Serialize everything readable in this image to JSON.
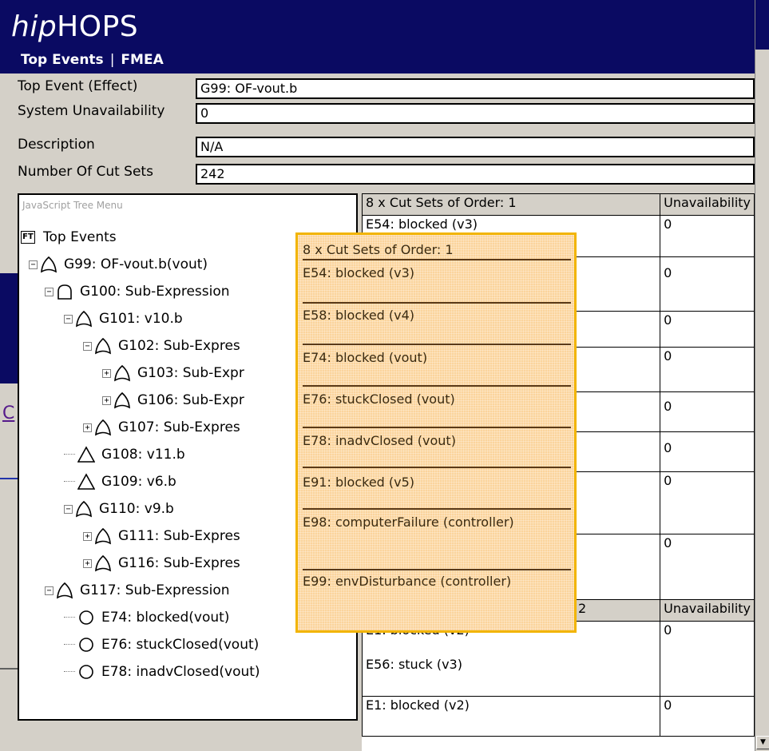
{
  "header": {
    "app_title_italic": "hip",
    "app_title_rest": "HOPS",
    "nav": [
      "Top Events",
      "|",
      "FMEA"
    ]
  },
  "info": [
    {
      "label": "Top Event (Effect)",
      "value": "G99: OF-vout.b"
    },
    {
      "label": "System Unavailability",
      "value": "0"
    },
    {
      "label": "Description",
      "value": "N/A"
    },
    {
      "label": "Number Of Cut Sets",
      "value": "242"
    }
  ],
  "tree": {
    "header": "JavaScript Tree Menu",
    "root_icon": "FT",
    "nodes": [
      {
        "label": "Top Events",
        "icon": "root-icon"
      },
      {
        "label": "G99: OF-vout.b(vout)",
        "icon": "or-gate-icon",
        "toggle": "−"
      },
      {
        "label": "G100: Sub-Expression",
        "icon": "and-gate-icon",
        "toggle": "−"
      },
      {
        "label": "G101: v10.b",
        "icon": "or-gate-icon",
        "toggle": "−"
      },
      {
        "label": "G102: Sub-Expres",
        "icon": "or-gate-icon",
        "toggle": "−"
      },
      {
        "label": "G103: Sub-Expr",
        "icon": "or-gate-icon",
        "toggle": "+"
      },
      {
        "label": "G106: Sub-Expr",
        "icon": "or-gate-icon",
        "toggle": "+"
      },
      {
        "label": "G107: Sub-Expres",
        "icon": "or-gate-icon",
        "toggle": "+"
      },
      {
        "label": "G108: v11.b",
        "icon": "triangle-icon"
      },
      {
        "label": "G109: v6.b",
        "icon": "triangle-icon"
      },
      {
        "label": "G110: v9.b",
        "icon": "or-gate-icon",
        "toggle": "−"
      },
      {
        "label": "G111: Sub-Expres",
        "icon": "or-gate-icon",
        "toggle": "+"
      },
      {
        "label": "G116: Sub-Expres",
        "icon": "or-gate-icon",
        "toggle": "+"
      },
      {
        "label": "G117: Sub-Expression",
        "icon": "or-gate-icon",
        "toggle": "−"
      },
      {
        "label": "E74: blocked(vout)",
        "icon": "circle-icon"
      },
      {
        "label": "E76: stuckClosed(vout)",
        "icon": "circle-icon"
      },
      {
        "label": "E78: inadvClosed(vout)",
        "icon": "circle-icon"
      }
    ]
  },
  "table": {
    "section1_header": "8 x Cut Sets of Order: 1",
    "section2_header": "2",
    "unavail_header": "Unavailability",
    "section1_rows": [
      {
        "cut": "E54: blocked (v3)",
        "un": "0"
      },
      {
        "cut": "",
        "un": "0"
      },
      {
        "cut": "",
        "un": "0"
      },
      {
        "cut": "",
        "un": "0"
      },
      {
        "cut": "",
        "un": "0"
      },
      {
        "cut": "",
        "un": "0"
      },
      {
        "cut": "",
        "un": "0"
      },
      {
        "cut": "",
        "un": "0"
      }
    ],
    "section2_rows": [
      {
        "cut": "E1: blocked (v2)",
        "un": "0",
        "cut2": "E56: stuck (v3)"
      },
      {
        "cut": "E1: blocked (v2)",
        "un": "0"
      }
    ]
  },
  "popup": {
    "title": "8 x Cut Sets of Order: 1",
    "items": [
      "E54: blocked (v3)",
      "E58: blocked (v4)",
      "E74: blocked (vout)",
      "E76: stuckClosed (vout)",
      "E78: inadvClosed (vout)",
      "E91: blocked (v5)",
      "E98: computerFailure (controller)",
      "E99: envDisturbance (controller)"
    ]
  },
  "colors": {
    "header_bg": "#0a0a62",
    "popup_bg": "#fbd49c",
    "popup_border": "#f2b400"
  }
}
